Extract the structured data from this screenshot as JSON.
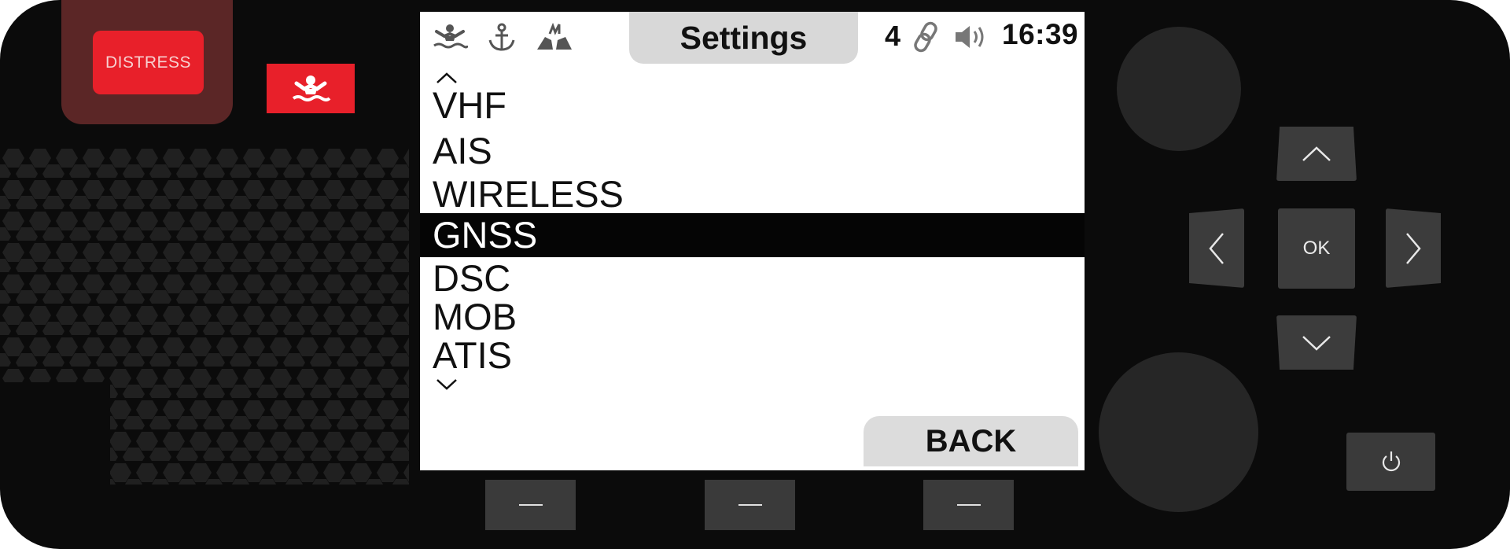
{
  "device": {
    "distress_label": "DISTRESS"
  },
  "screen": {
    "title": "Settings",
    "status": {
      "icons": [
        "man-overboard-icon",
        "anchor-icon",
        "collision-icon",
        "link-icon",
        "speaker-icon"
      ],
      "channel_count": "4",
      "time": "16:39"
    },
    "menu": {
      "items": [
        "VHF",
        "AIS",
        "WIRELESS",
        "GNSS",
        "DSC",
        "MOB",
        "ATIS"
      ],
      "selected": "GNSS"
    },
    "back_label": "BACK"
  },
  "controls": {
    "ok_label": "OK"
  },
  "colors": {
    "body": "#0b0b0b",
    "distress_red": "#e8202a",
    "distress_pod": "#5b2626",
    "button_grey": "#3c3c3c",
    "screen_bg": "#ffffff",
    "selection": "#050505",
    "tab_grey": "#d8d8d8"
  }
}
